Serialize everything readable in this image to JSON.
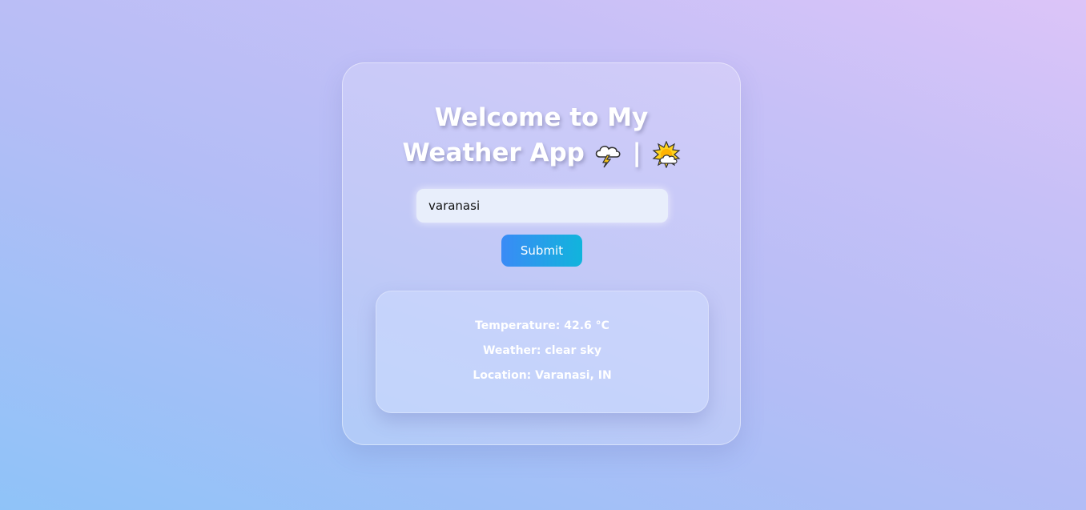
{
  "app": {
    "title": "Welcome to My Weather App",
    "title_separator": "|",
    "title_icons": [
      "thunder-cloud-icon",
      "sun-behind-cloud-icon"
    ]
  },
  "search": {
    "value": "varanasi"
  },
  "submit_label": "Submit",
  "result": {
    "temperature": "Temperature: 42.6 °C",
    "weather": "Weather: clear sky",
    "location": "Location: Varanasi, IN"
  },
  "colors": {
    "button_start": "#3a8bf6",
    "button_end": "#11b4dc",
    "background_start": "#8fc3f8",
    "background_end": "#dcc4f8"
  }
}
